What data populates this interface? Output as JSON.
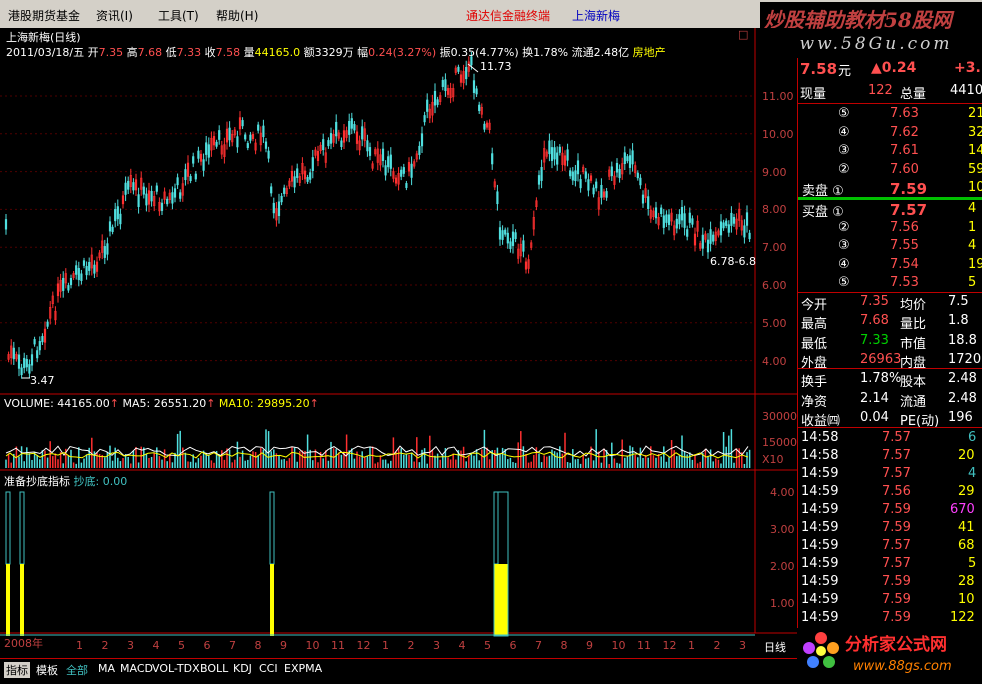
{
  "menubar": {
    "items": [
      "港股期货基金",
      "资讯(I)",
      "工具(T)",
      "帮助(H)"
    ],
    "promo_red": "通达信金融终端",
    "promo_blue": "上海新梅"
  },
  "watermark": {
    "line1": "炒股辅助教材58股网",
    "line2": "www.58Gu.com",
    "close": "□"
  },
  "chart": {
    "stock_title": "上海新梅(日线)",
    "close_icon": "□",
    "ohlc": {
      "date": "2011/03/18/五",
      "open_label": "开",
      "open": "7.35",
      "high_label": "高",
      "high": "7.68",
      "low_label": "低",
      "low": "7.33",
      "close_label": "收",
      "close": "7.58",
      "vol_label": "量",
      "vol": "44165.0",
      "amt_label": "额",
      "amt": "3329万",
      "chg_label": "幅",
      "chg": "0.24(3.27%)",
      "amp_label": "振",
      "amp": "0.35(4.77%)",
      "turn_label": "换",
      "turn": "1.78%",
      "float_label": "流通",
      "float": "2.48亿",
      "sector": "房地产"
    },
    "price_axis": [
      "11.00",
      "10.00",
      "9.00",
      "8.00",
      "7.00",
      "6.00",
      "5.00",
      "4.00"
    ],
    "max_label": "11.73",
    "min_label": "3.47",
    "last_label": "6.78-6.8",
    "volume": {
      "label": "VOLUME: 44165.00",
      "ma5": "MA5: 26551.20",
      "ma10": "MA10: 29895.20",
      "axis": [
        "30000",
        "15000",
        "X10"
      ]
    },
    "indicator": {
      "title": "准备抄底指标",
      "value": "抄底: 0.00",
      "axis": [
        "4.00",
        "3.00",
        "2.00",
        "1.00"
      ]
    },
    "date_axis": {
      "year": "2008年",
      "months": [
        "1",
        "2",
        "3",
        "4",
        "5",
        "6",
        "7",
        "8",
        "9",
        "10",
        "11",
        "12",
        "1",
        "2",
        "3",
        "4",
        "5",
        "6",
        "7",
        "8",
        "9",
        "10",
        "11",
        "12",
        "1",
        "2",
        "3"
      ],
      "period": "日线"
    }
  },
  "quote": {
    "price": "7.58",
    "price_unit": "元",
    "change": "▲0.24",
    "change_pct": "+3.",
    "volume_now_label": "现量",
    "volume_now": "122",
    "volume_total_label": "总量",
    "volume_total": "4410",
    "asks": [
      {
        "level": "⑤",
        "price": "7.63",
        "vol": "21"
      },
      {
        "level": "④",
        "price": "7.62",
        "vol": "32"
      },
      {
        "level": "③",
        "price": "7.61",
        "vol": "14"
      },
      {
        "level": "②",
        "price": "7.60",
        "vol": "59"
      },
      {
        "level": "卖盘 ①",
        "price": "7.59",
        "vol": "10"
      }
    ],
    "bids": [
      {
        "level": "买盘 ①",
        "price": "7.57",
        "vol": "4"
      },
      {
        "level": "②",
        "price": "7.56",
        "vol": "1"
      },
      {
        "level": "③",
        "price": "7.55",
        "vol": "4"
      },
      {
        "level": "④",
        "price": "7.54",
        "vol": "19"
      },
      {
        "level": "⑤",
        "price": "7.53",
        "vol": "5"
      }
    ],
    "stats": [
      {
        "l1": "今开",
        "v1": "7.35",
        "c1": "r",
        "l2": "均价",
        "v2": "7.5"
      },
      {
        "l1": "最高",
        "v1": "7.68",
        "c1": "r",
        "l2": "量比",
        "v2": "1.8"
      },
      {
        "l1": "最低",
        "v1": "7.33",
        "c1": "g",
        "l2": "市值",
        "v2": "18.8"
      },
      {
        "l1": "外盘",
        "v1": "26963",
        "c1": "r",
        "l2": "内盘",
        "v2": "1720"
      },
      {
        "l1": "换手",
        "v1": "1.78%",
        "c1": "w",
        "l2": "股本",
        "v2": "2.48"
      },
      {
        "l1": "净资",
        "v1": "2.14",
        "c1": "w",
        "l2": "流通",
        "v2": "2.48"
      },
      {
        "l1": "收益㈣",
        "v1": "0.04",
        "c1": "w",
        "l2": "PE(动)",
        "v2": "196"
      }
    ],
    "ticks": [
      {
        "time": "14:58",
        "price": "7.57",
        "vol": "6",
        "vc": "c"
      },
      {
        "time": "14:58",
        "price": "7.57",
        "vol": "20",
        "vc": "y"
      },
      {
        "time": "14:59",
        "price": "7.57",
        "vol": "4",
        "vc": "c"
      },
      {
        "time": "14:59",
        "price": "7.56",
        "vol": "29",
        "vc": "y"
      },
      {
        "time": "14:59",
        "price": "7.59",
        "vol": "670",
        "vc": "m"
      },
      {
        "time": "14:59",
        "price": "7.59",
        "vol": "41",
        "vc": "y"
      },
      {
        "time": "14:59",
        "price": "7.57",
        "vol": "68",
        "vc": "y"
      },
      {
        "time": "14:59",
        "price": "7.57",
        "vol": "5",
        "vc": "y"
      },
      {
        "time": "14:59",
        "price": "7.59",
        "vol": "28",
        "vc": "y"
      },
      {
        "time": "14:59",
        "price": "7.59",
        "vol": "10",
        "vc": "y"
      },
      {
        "time": "14:59",
        "price": "7.59",
        "vol": "122",
        "vc": "y"
      }
    ]
  },
  "bottom_tabs": [
    "指标",
    "模板",
    "全部",
    "MA",
    "MACD",
    "VOL-TDX",
    "BOLL",
    "KDJ",
    "CCI",
    "EXPMA"
  ],
  "logo": {
    "line1": "分析家公式网",
    "line2": "www.88gs.com"
  }
}
